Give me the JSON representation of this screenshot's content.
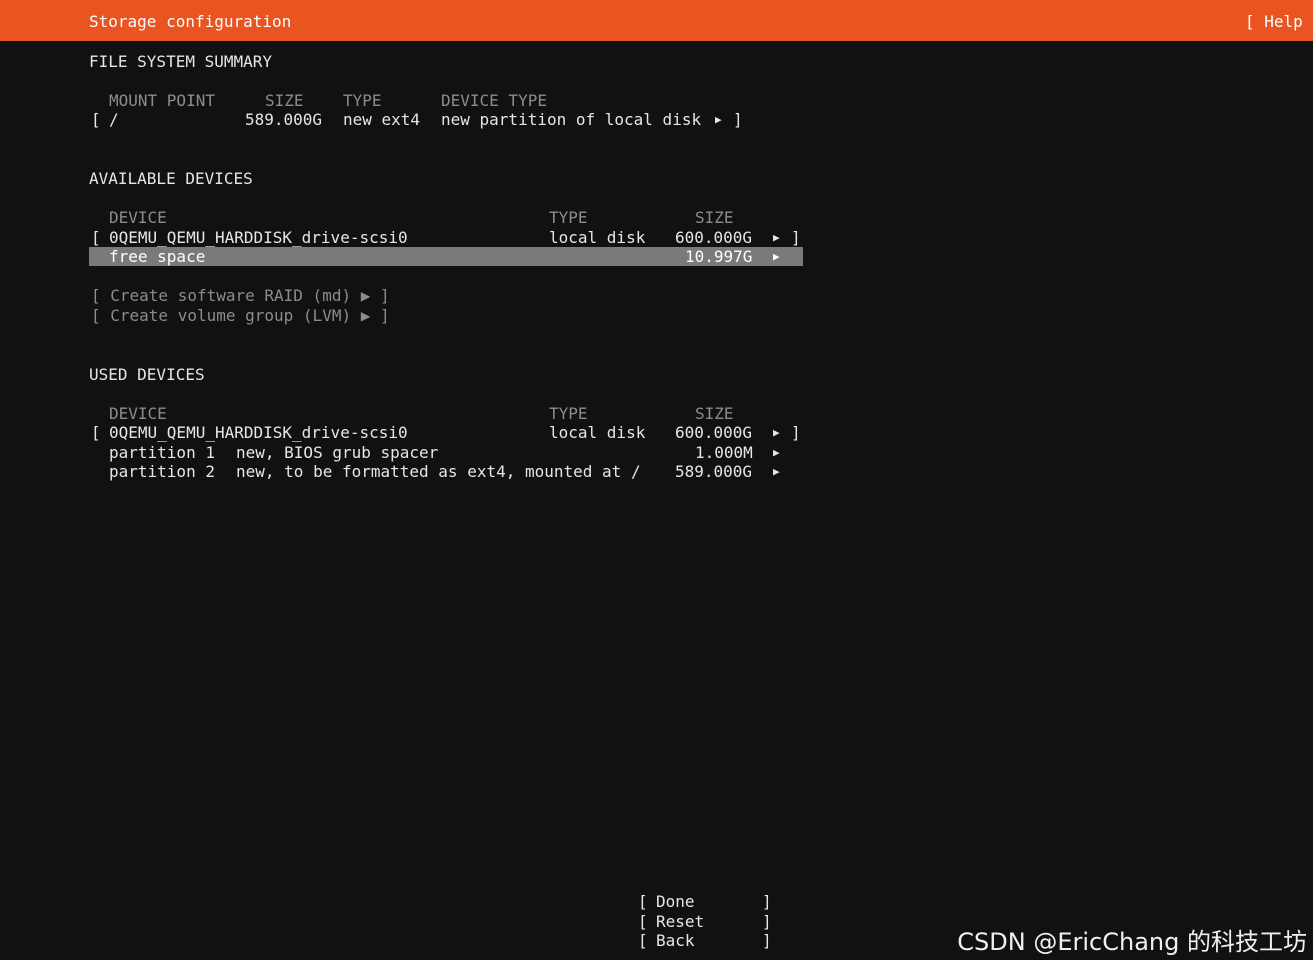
{
  "header": {
    "title": "Storage configuration",
    "help_label": "[ Help ]",
    "accent_color": "#e95420"
  },
  "fs_summary": {
    "heading": "FILE SYSTEM SUMMARY",
    "columns": [
      "MOUNT POINT",
      "SIZE",
      "TYPE",
      "DEVICE TYPE"
    ],
    "rows": [
      {
        "open": "[",
        "mount": "/",
        "size": "589.000G",
        "type": "new ext4",
        "device_type": "new partition of local disk",
        "arrow": "▶",
        "close": "]"
      }
    ]
  },
  "available": {
    "heading": "AVAILABLE DEVICES",
    "columns": [
      "DEVICE",
      "TYPE",
      "SIZE"
    ],
    "disk": {
      "open": "[",
      "name": "0QEMU_QEMU_HARDDISK_drive-scsi0",
      "type": "local disk",
      "size": "600.000G",
      "arrow": "▶",
      "close": "]"
    },
    "free_space": {
      "label": "free space",
      "size": "10.997G",
      "arrow": "▶"
    },
    "actions": [
      {
        "label": "[ Create software RAID (md) ▶ ]"
      },
      {
        "label": "[ Create volume group (LVM) ▶ ]"
      }
    ]
  },
  "used": {
    "heading": "USED DEVICES",
    "columns": [
      "DEVICE",
      "TYPE",
      "SIZE"
    ],
    "disk": {
      "open": "[",
      "name": "0QEMU_QEMU_HARDDISK_drive-scsi0",
      "type": "local disk",
      "size": "600.000G",
      "arrow": "▶",
      "close": "]"
    },
    "partitions": [
      {
        "name": "partition 1",
        "desc": "new, BIOS grub spacer",
        "size": "1.000M",
        "arrow": "▶"
      },
      {
        "name": "partition 2",
        "desc": "new, to be formatted as ext4, mounted at /",
        "size": "589.000G",
        "arrow": "▶"
      }
    ]
  },
  "buttons": [
    {
      "open": "[",
      "label": "Done",
      "close": "]"
    },
    {
      "open": "[",
      "label": "Reset",
      "close": "]"
    },
    {
      "open": "[",
      "label": "Back",
      "close": "]"
    }
  ],
  "watermark": "CSDN @EricChang 的科技工坊"
}
